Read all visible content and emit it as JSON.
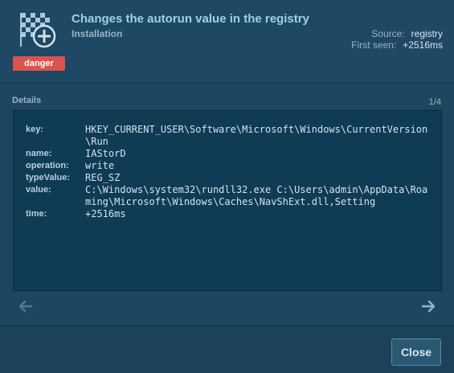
{
  "header": {
    "title": "Changes the autorun value in the registry",
    "subtitle": "Installation",
    "icon": "checkered-flag-plus-icon",
    "badge": "danger",
    "meta": {
      "source_label": "Source:",
      "source_value": "registry",
      "first_seen_label": "First seen:",
      "first_seen_value": "+2516ms"
    }
  },
  "details": {
    "label": "Details",
    "counter": "1/4",
    "rows": [
      {
        "key": "key:",
        "value": "HKEY_CURRENT_USER\\Software\\Microsoft\\Windows\\CurrentVersion\\Run"
      },
      {
        "key": "name:",
        "value": "IAStorD"
      },
      {
        "key": "operation:",
        "value": "write"
      },
      {
        "key": "typeValue:",
        "value": "REG_SZ"
      },
      {
        "key": "value:",
        "value": "C:\\Windows\\system32\\rundll32.exe C:\\Users\\admin\\AppData\\Roaming\\Microsoft\\Windows\\Caches\\NavShExt.dll,Setting"
      },
      {
        "key": "time:",
        "value": "+2516ms"
      }
    ]
  },
  "nav": {
    "prev_icon": "arrow-left-icon",
    "next_icon": "arrow-right-icon"
  },
  "footer": {
    "close_label": "Close"
  },
  "colors": {
    "danger": "#d9534f",
    "background": "#1d4660",
    "panel": "#0f3b55"
  }
}
